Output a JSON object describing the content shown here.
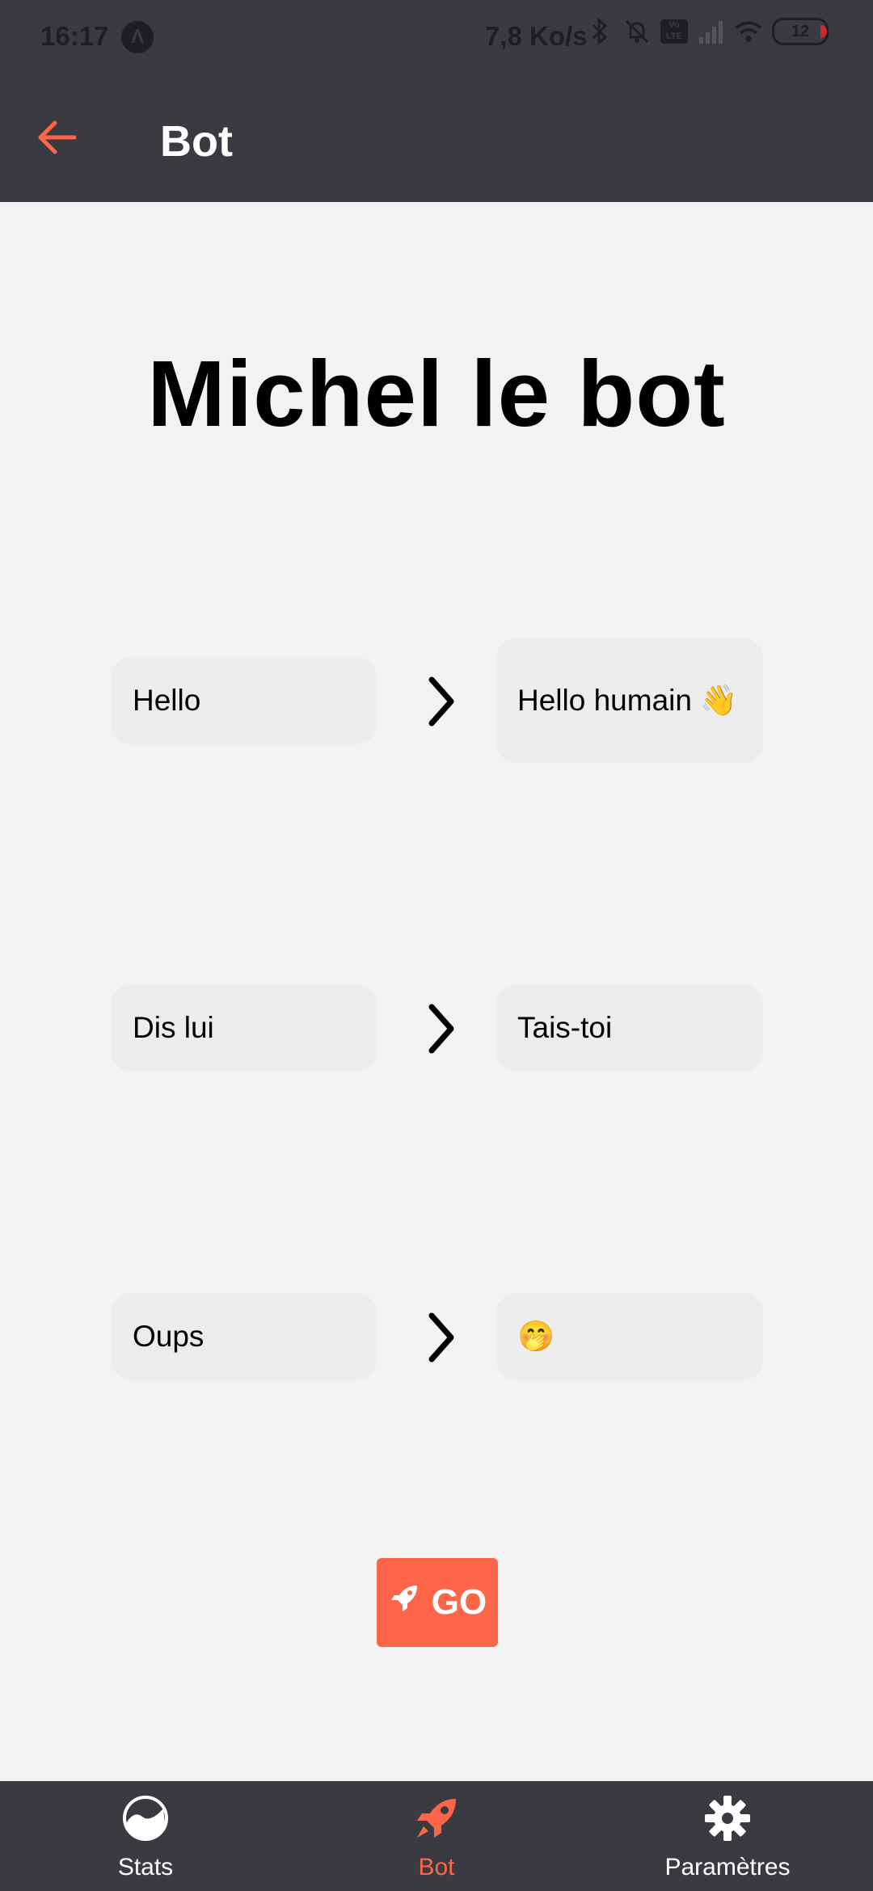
{
  "status_bar": {
    "time": "16:17",
    "app_badge": "Λ",
    "network_speed": "7,8 Ko/s",
    "volte_label": "Vo LTE",
    "battery": "12"
  },
  "app_bar": {
    "title": "Bot"
  },
  "page": {
    "heading": "Michel le bot"
  },
  "rules": [
    {
      "trigger": "Hello",
      "response": "Hello humain 👋"
    },
    {
      "trigger": "Dis lui",
      "response": "Tais-toi"
    },
    {
      "trigger": "Oups",
      "response": "🤭"
    }
  ],
  "go_button": {
    "label": "GO"
  },
  "bottom_nav": [
    {
      "label": "Stats",
      "icon": "chart-wave-icon"
    },
    {
      "label": "Bot",
      "icon": "rocket-icon"
    },
    {
      "label": "Paramètres",
      "icon": "gear-icon"
    }
  ],
  "colors": {
    "accent": "#fe6649",
    "bar": "#393b40",
    "background": "#f2f2f2",
    "field": "#ececec"
  }
}
